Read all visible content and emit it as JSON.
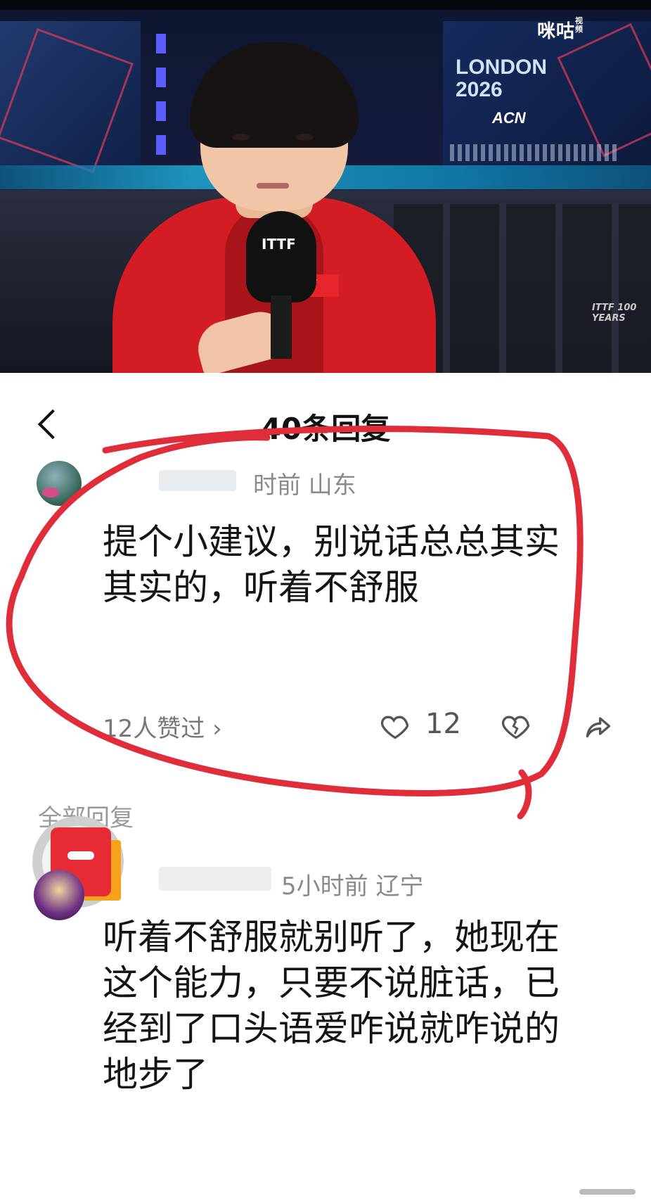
{
  "video": {
    "watermark": "咪咕",
    "watermark_sub": "视频",
    "poster_title": "LONDON 2026",
    "poster_sub": "ACN",
    "mic_logo": "ITTF",
    "corner_logo": "ITTF 100 YEARS"
  },
  "header": {
    "title": "40条回复",
    "back_icon": "chevron-left-icon"
  },
  "main_comment": {
    "meta": "时前  山东",
    "text": "提个小建议，别说话总总其实其实的，听着不舒服",
    "likes_link": "12人赞过 ›",
    "like_count": "12",
    "icons": [
      "heart-icon",
      "broken-heart-icon",
      "share-icon"
    ]
  },
  "replies": {
    "section_label": "全部回复",
    "items": [
      {
        "meta": "5小时前  辽宁",
        "text": "听着不舒服就别听了，她现在这个能力，只要不说脏话，已经到了口头语爱咋说就咋说的地步了"
      }
    ]
  },
  "colors": {
    "annotation_red": "#e02d3a",
    "jacket_red": "#d41c24",
    "text_primary": "#141414",
    "text_meta": "#8a8a8a"
  }
}
